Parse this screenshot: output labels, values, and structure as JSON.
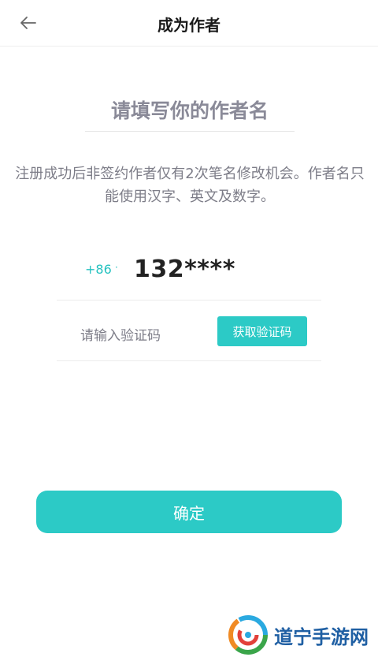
{
  "header": {
    "title": "成为作者",
    "back_icon": "arrow-left-icon"
  },
  "author_name": {
    "placeholder": "请填写你的作者名",
    "value": ""
  },
  "notice": "注册成功后非签约作者仅有2次笔名修改机会。作者名只能使用汉字、英文及数字。",
  "phone": {
    "country_code": "+86",
    "caret": "·",
    "number": "132****"
  },
  "verification": {
    "placeholder": "请输入验证码",
    "value": "",
    "get_code_label": "获取验证码"
  },
  "confirm_label": "确定",
  "watermark": {
    "text": "道宁手游网"
  },
  "colors": {
    "accent": "#2ccac6",
    "notice_text": "#7d7d88",
    "watermark_text": "#1f5fa3"
  }
}
